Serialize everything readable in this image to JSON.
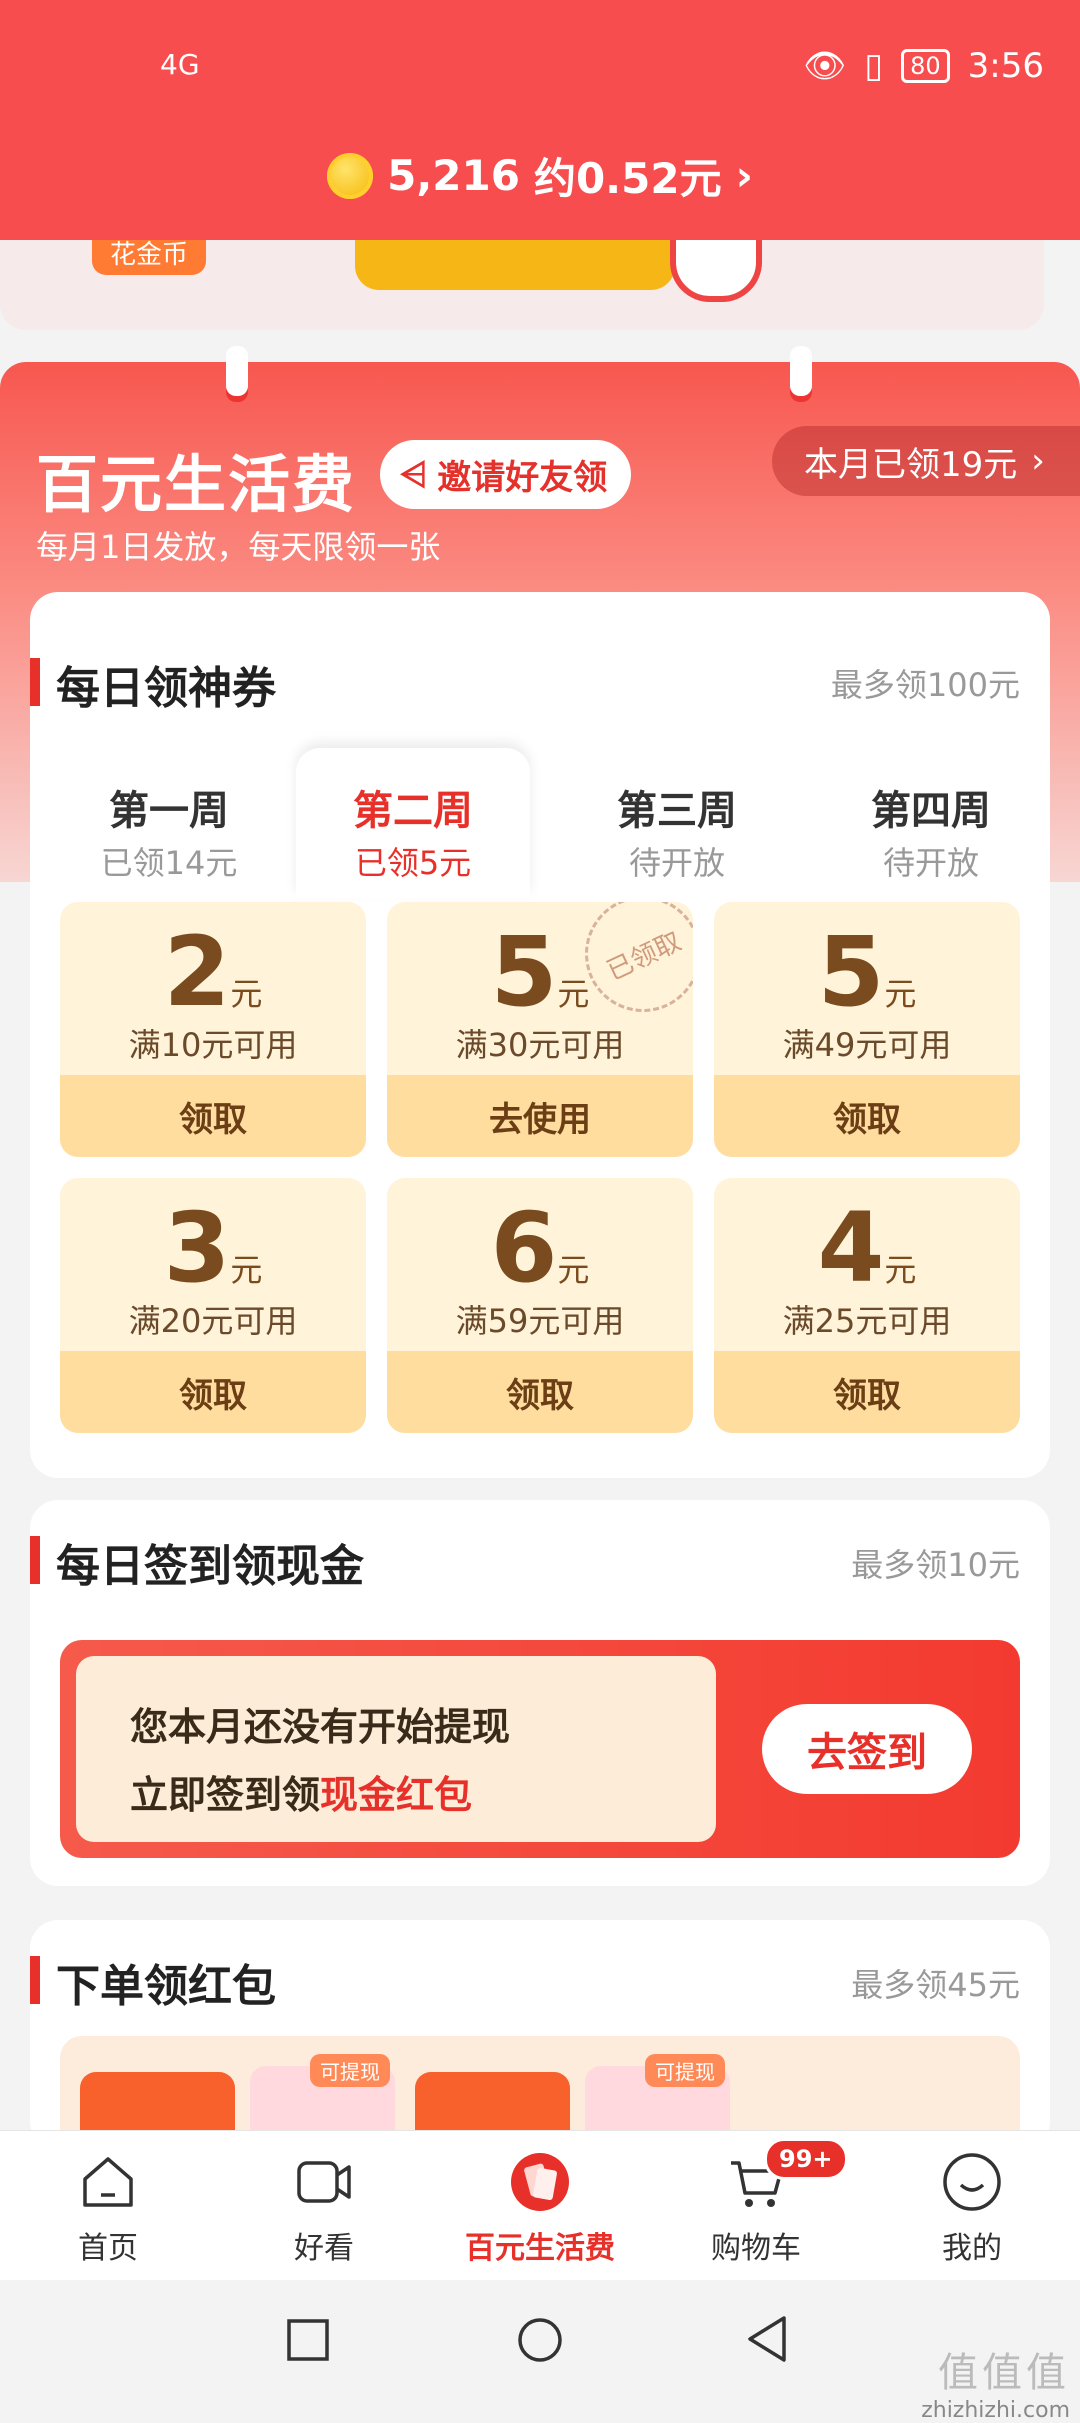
{
  "status": {
    "network": "4G",
    "battery": "80",
    "time": "3:56"
  },
  "header": {
    "coins": "5,216",
    "cash_approx": "约0.52元"
  },
  "banner": {
    "tag": "花金币"
  },
  "hero": {
    "title": "百元生活费",
    "invite_label": "邀请好友领",
    "subtitle": "每月1日发放，每天限领一张",
    "month_claimed": "本月已领19元"
  },
  "coupons_section": {
    "title": "每日领神券",
    "max_text": "最多领100元",
    "weeks": [
      {
        "name": "第一周",
        "status": "已领14元"
      },
      {
        "name": "第二周",
        "status": "已领5元"
      },
      {
        "name": "第三周",
        "status": "待开放"
      },
      {
        "name": "第四周",
        "status": "待开放"
      }
    ],
    "unit": "元",
    "stamp": "已领取",
    "coupons": [
      {
        "amount": "2",
        "condition": "满10元可用",
        "action": "领取"
      },
      {
        "amount": "5",
        "condition": "满30元可用",
        "action": "去使用"
      },
      {
        "amount": "5",
        "condition": "满49元可用",
        "action": "领取"
      },
      {
        "amount": "3",
        "condition": "满20元可用",
        "action": "领取"
      },
      {
        "amount": "6",
        "condition": "满59元可用",
        "action": "领取"
      },
      {
        "amount": "4",
        "condition": "满25元可用",
        "action": "领取"
      }
    ]
  },
  "signin_section": {
    "title": "每日签到领现金",
    "max_text": "最多领10元",
    "line1": "您本月还没有开始提现",
    "line2_prefix": "立即签到领",
    "line2_highlight": "现金红包",
    "button": "去签到"
  },
  "order_section": {
    "title": "下单领红包",
    "max_text": "最多领45元",
    "tag": "可提现"
  },
  "tabbar": {
    "items": [
      "首页",
      "好看",
      "百元生活费",
      "购物车",
      "我的"
    ],
    "cart_badge": "99+"
  },
  "watermark": {
    "line1": "值值值",
    "line2": "zhizhizhi.com"
  },
  "colors": {
    "brand_red": "#e8302a",
    "header_red": "#f84d4f",
    "coupon_bg": "#fff3d9"
  }
}
